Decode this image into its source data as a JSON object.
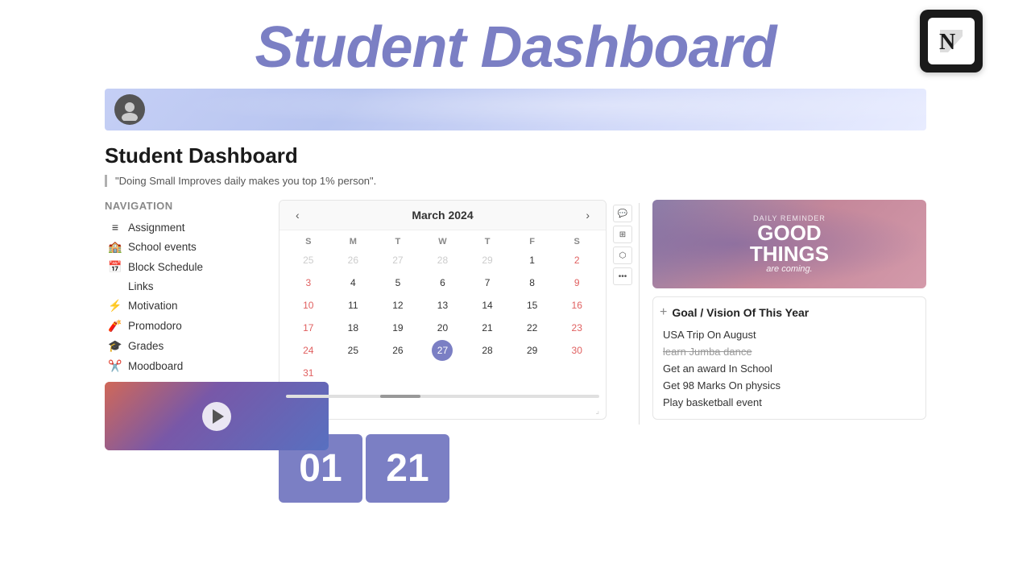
{
  "app": {
    "main_title": "Student Dashboard",
    "notion_logo_alt": "Notion logo"
  },
  "header": {
    "avatar_alt": "User avatar"
  },
  "page": {
    "title": "Student Dashboard",
    "quote": "\"Doing Small Improves daily makes you top 1% person\"."
  },
  "navigation": {
    "title": "Navigation",
    "items": [
      {
        "id": "assignment",
        "icon": "≡",
        "label": "Assignment"
      },
      {
        "id": "school-events",
        "icon": "🏫",
        "label": "School events"
      },
      {
        "id": "block-schedule",
        "icon": "📅",
        "label": "Block Schedule"
      },
      {
        "id": "links",
        "icon": "</>",
        "label": "Links"
      },
      {
        "id": "motivation",
        "icon": "⚡",
        "label": "Motivation"
      },
      {
        "id": "promodoro",
        "icon": "🧨",
        "label": "Promodoro"
      },
      {
        "id": "grades",
        "icon": "🎓",
        "label": "Grades"
      },
      {
        "id": "moodboard",
        "icon": "✂️",
        "label": "Moodboard"
      }
    ]
  },
  "calendar": {
    "month_label": "March 2024",
    "prev_btn": "‹",
    "next_btn": "›",
    "day_headers": [
      "S",
      "M",
      "T",
      "W",
      "T",
      "F",
      "S"
    ],
    "toolbar_icons": [
      "💬",
      "⊞",
      "⬡",
      "⋯"
    ],
    "weeks": [
      [
        "",
        "25",
        "26",
        "27",
        "28",
        "29",
        "1",
        "2"
      ],
      [
        "3",
        "4",
        "5",
        "6",
        "7",
        "8",
        "9"
      ],
      [
        "10",
        "11",
        "12",
        "13",
        "14",
        "15",
        "16"
      ],
      [
        "17",
        "18",
        "19",
        "20",
        "21",
        "22",
        "23"
      ],
      [
        "24",
        "25",
        "26",
        "27",
        "28",
        "29",
        "30"
      ],
      [
        "31",
        "",
        "",
        "",
        "",
        "",
        ""
      ]
    ],
    "today_date": "27",
    "today_row": 4,
    "today_col": 3
  },
  "motivational": {
    "daily_reminder": "Daily Reminder",
    "line1": "GOOD",
    "line2": "THINGS",
    "line3": "are coming."
  },
  "goals": {
    "title": "Goal / Vision Of This Year",
    "add_label": "+",
    "items": [
      {
        "text": "USA Trip On August",
        "strikethrough": false
      },
      {
        "text": "learn Jumba dance",
        "strikethrough": true
      },
      {
        "text": "Get an award In School",
        "strikethrough": false
      },
      {
        "text": "Get 98 Marks On physics",
        "strikethrough": false
      },
      {
        "text": "Play basketball event",
        "strikethrough": false
      }
    ]
  },
  "bottom": {
    "number1": "01",
    "number2": "21"
  }
}
